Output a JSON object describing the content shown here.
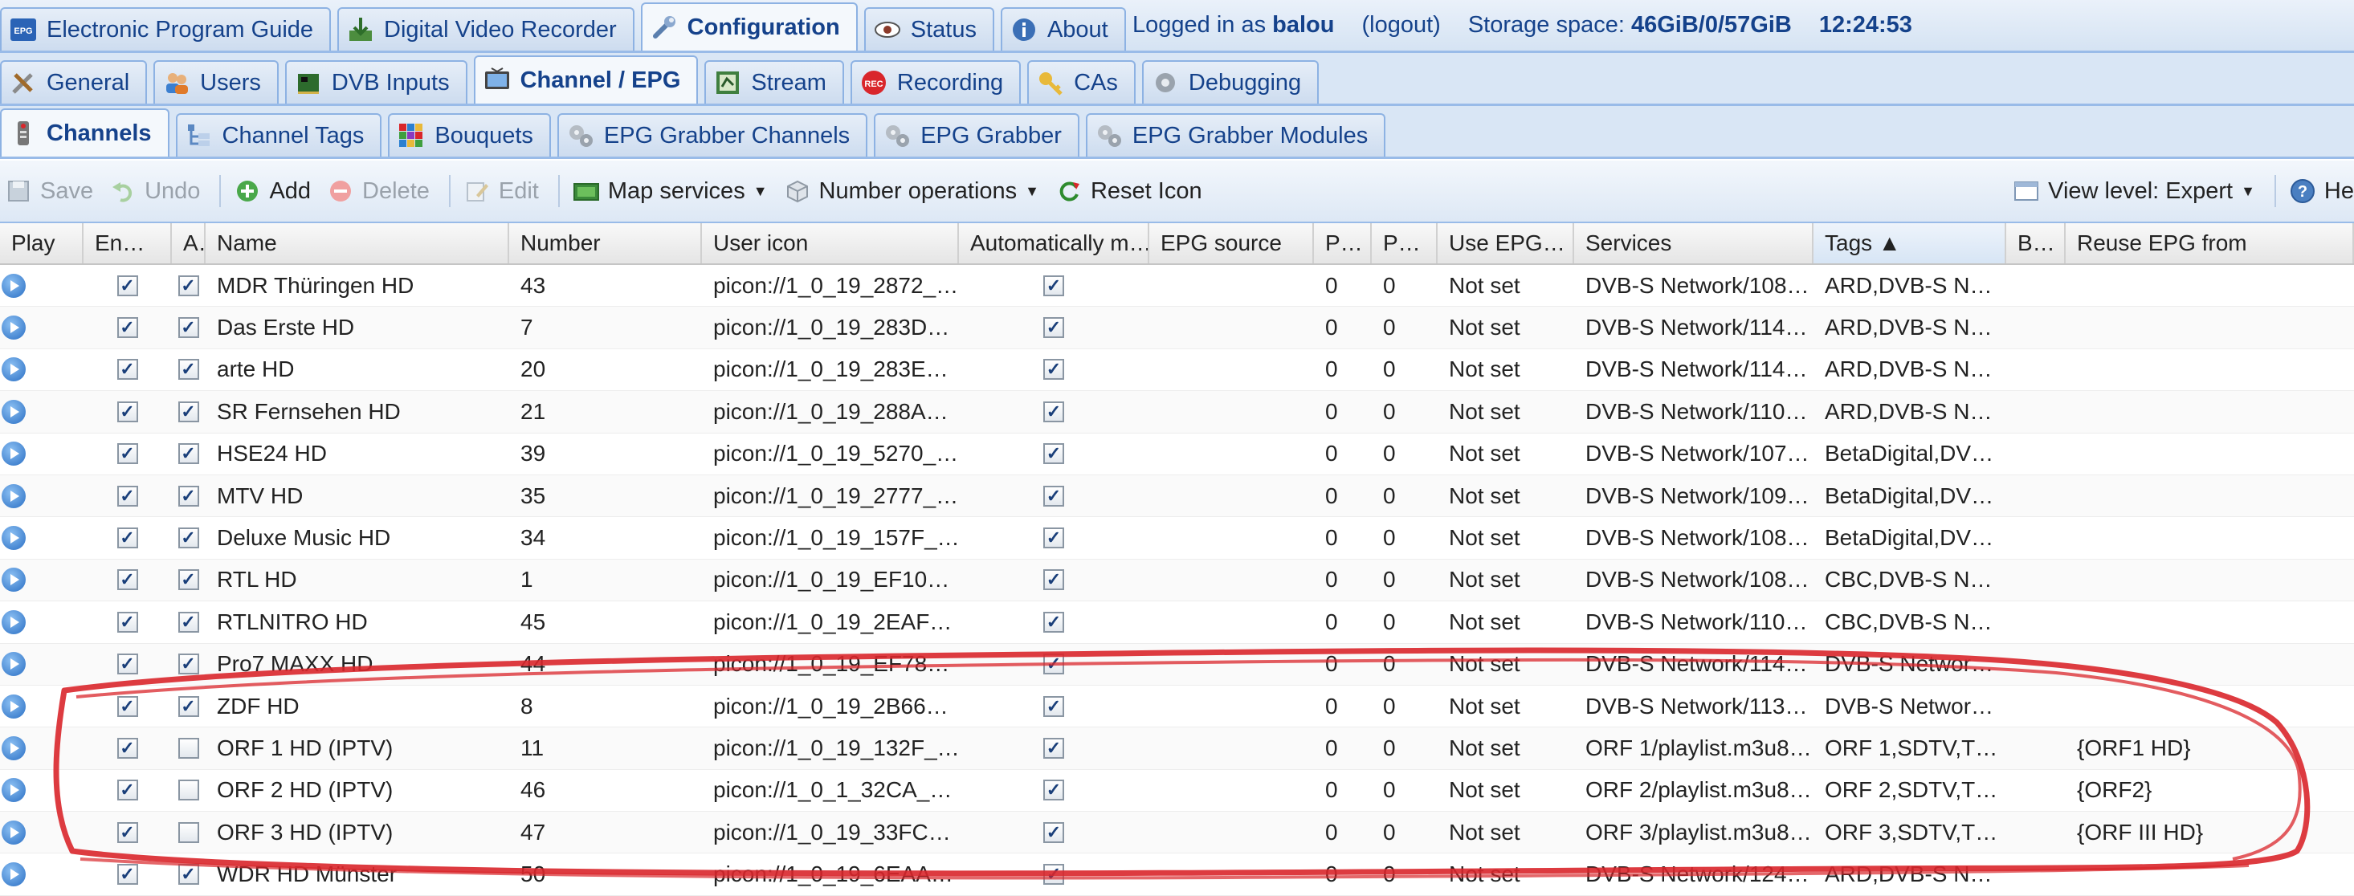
{
  "top_tabs": [
    {
      "label": "Electronic Program Guide",
      "icon": "epg-icon",
      "active": false
    },
    {
      "label": "Digital Video Recorder",
      "icon": "download-icon",
      "active": false
    },
    {
      "label": "Configuration",
      "icon": "wrench-icon",
      "active": true
    },
    {
      "label": "Status",
      "icon": "eye-icon",
      "active": false
    },
    {
      "label": "About",
      "icon": "info-icon",
      "active": false
    }
  ],
  "status_bar": {
    "logged_in_prefix": "Logged in as",
    "username": "balou",
    "logout": "(logout)",
    "storage_label": "Storage space:",
    "storage_value": "46GiB/0/57GiB",
    "time": "12:24:53"
  },
  "config_tabs": [
    {
      "label": "General",
      "icon": "tools-icon",
      "active": false
    },
    {
      "label": "Users",
      "icon": "users-icon",
      "active": false
    },
    {
      "label": "DVB Inputs",
      "icon": "dvb-card-icon",
      "active": false
    },
    {
      "label": "Channel / EPG",
      "icon": "tv-icon",
      "active": true
    },
    {
      "label": "Stream",
      "icon": "stream-icon",
      "active": false
    },
    {
      "label": "Recording",
      "icon": "rec-icon",
      "active": false
    },
    {
      "label": "CAs",
      "icon": "key-icon",
      "active": false
    },
    {
      "label": "Debugging",
      "icon": "bug-gear-icon",
      "active": false
    }
  ],
  "sub_tabs": [
    {
      "label": "Channels",
      "icon": "remote-icon",
      "active": true
    },
    {
      "label": "Channel Tags",
      "icon": "tree-icon",
      "active": false
    },
    {
      "label": "Bouquets",
      "icon": "grid-color-icon",
      "active": false
    },
    {
      "label": "EPG Grabber Channels",
      "icon": "gears-icon",
      "active": false
    },
    {
      "label": "EPG Grabber",
      "icon": "gears-icon",
      "active": false
    },
    {
      "label": "EPG Grabber Modules",
      "icon": "gears-icon",
      "active": false
    }
  ],
  "toolbar": {
    "save": "Save",
    "undo": "Undo",
    "add": "Add",
    "delete": "Delete",
    "edit": "Edit",
    "map_services": "Map services",
    "number_operations": "Number operations",
    "reset_icon": "Reset Icon",
    "view_level": "View level: Expert",
    "help": "He"
  },
  "columns": [
    "Play",
    "En…",
    "A…",
    "Name",
    "Number",
    "User icon",
    "Automatically m…",
    "EPG source",
    "P…",
    "P…",
    "Use EPG…",
    "Services",
    "Tags ▲",
    "B…",
    "Reuse EPG from"
  ],
  "rows": [
    {
      "name": "MDR Thüringen HD",
      "number": "43",
      "icon": "picon://1_0_19_2872_…",
      "auto": true,
      "en": true,
      "a": true,
      "p1": "0",
      "p2": "0",
      "use_epg": "Not set",
      "services": "DVB-S Network/108…",
      "tags": "ARD,DVB-S N…",
      "reuse": ""
    },
    {
      "name": "Das Erste HD",
      "number": "7",
      "icon": "picon://1_0_19_283D…",
      "auto": true,
      "en": true,
      "a": true,
      "p1": "0",
      "p2": "0",
      "use_epg": "Not set",
      "services": "DVB-S Network/114…",
      "tags": "ARD,DVB-S N…",
      "reuse": ""
    },
    {
      "name": "arte HD",
      "number": "20",
      "icon": "picon://1_0_19_283E…",
      "auto": true,
      "en": true,
      "a": true,
      "p1": "0",
      "p2": "0",
      "use_epg": "Not set",
      "services": "DVB-S Network/114…",
      "tags": "ARD,DVB-S N…",
      "reuse": ""
    },
    {
      "name": "SR Fernsehen HD",
      "number": "21",
      "icon": "picon://1_0_19_288A…",
      "auto": true,
      "en": true,
      "a": true,
      "p1": "0",
      "p2": "0",
      "use_epg": "Not set",
      "services": "DVB-S Network/110…",
      "tags": "ARD,DVB-S N…",
      "reuse": ""
    },
    {
      "name": "HSE24 HD",
      "number": "39",
      "icon": "picon://1_0_19_5270_…",
      "auto": true,
      "en": true,
      "a": true,
      "p1": "0",
      "p2": "0",
      "use_epg": "Not set",
      "services": "DVB-S Network/107…",
      "tags": "BetaDigital,DV…",
      "reuse": ""
    },
    {
      "name": "MTV HD",
      "number": "35",
      "icon": "picon://1_0_19_2777_…",
      "auto": true,
      "en": true,
      "a": true,
      "p1": "0",
      "p2": "0",
      "use_epg": "Not set",
      "services": "DVB-S Network/109…",
      "tags": "BetaDigital,DV…",
      "reuse": ""
    },
    {
      "name": "Deluxe Music HD",
      "number": "34",
      "icon": "picon://1_0_19_157F_…",
      "auto": true,
      "en": true,
      "a": true,
      "p1": "0",
      "p2": "0",
      "use_epg": "Not set",
      "services": "DVB-S Network/108…",
      "tags": "BetaDigital,DV…",
      "reuse": ""
    },
    {
      "name": "RTL HD",
      "number": "1",
      "icon": "picon://1_0_19_EF10…",
      "auto": true,
      "en": true,
      "a": true,
      "p1": "0",
      "p2": "0",
      "use_epg": "Not set",
      "services": "DVB-S Network/108…",
      "tags": "CBC,DVB-S N…",
      "reuse": ""
    },
    {
      "name": "RTLNITRO HD",
      "number": "45",
      "icon": "picon://1_0_19_2EAF…",
      "auto": true,
      "en": true,
      "a": true,
      "p1": "0",
      "p2": "0",
      "use_epg": "Not set",
      "services": "DVB-S Network/110…",
      "tags": "CBC,DVB-S N…",
      "reuse": ""
    },
    {
      "name": "Pro7 MAXX HD",
      "number": "44",
      "icon": "picon://1_0_19_EF78…",
      "auto": true,
      "en": true,
      "a": true,
      "p1": "0",
      "p2": "0",
      "use_epg": "Not set",
      "services": "DVB-S Network/114…",
      "tags": "DVB-S Networ…",
      "reuse": ""
    },
    {
      "name": "ZDF HD",
      "number": "8",
      "icon": "picon://1_0_19_2B66…",
      "auto": true,
      "en": true,
      "a": true,
      "p1": "0",
      "p2": "0",
      "use_epg": "Not set",
      "services": "DVB-S Network/113…",
      "tags": "DVB-S Networ…",
      "reuse": ""
    },
    {
      "name": "ORF 1 HD (IPTV)",
      "number": "11",
      "icon": "picon://1_0_19_132F_…",
      "auto": true,
      "en": true,
      "a": false,
      "p1": "0",
      "p2": "0",
      "use_epg": "Not set",
      "services": "ORF 1/playlist.m3u8…",
      "tags": "ORF 1,SDTV,T…",
      "reuse": "{ORF1 HD}"
    },
    {
      "name": "ORF 2 HD (IPTV)",
      "number": "46",
      "icon": "picon://1_0_1_32CA_…",
      "auto": true,
      "en": true,
      "a": false,
      "p1": "0",
      "p2": "0",
      "use_epg": "Not set",
      "services": "ORF 2/playlist.m3u8…",
      "tags": "ORF 2,SDTV,T…",
      "reuse": "{ORF2}"
    },
    {
      "name": "ORF 3 HD (IPTV)",
      "number": "47",
      "icon": "picon://1_0_19_33FC…",
      "auto": true,
      "en": true,
      "a": false,
      "p1": "0",
      "p2": "0",
      "use_epg": "Not set",
      "services": "ORF 3/playlist.m3u8…",
      "tags": "ORF 3,SDTV,T…",
      "reuse": "{ORF III HD}"
    },
    {
      "name": "WDR HD Münster",
      "number": "50",
      "icon": "picon://1_0_19_6EAA…",
      "auto": true,
      "en": true,
      "a": true,
      "p1": "0",
      "p2": "0",
      "use_epg": "Not set",
      "services": "DVB-S Network/124…",
      "tags": "ARD,DVB-S N…",
      "reuse": ""
    }
  ],
  "colors": {
    "tab_text": "#15428b",
    "border": "#99bbe8",
    "annotation": "#d9262b"
  }
}
